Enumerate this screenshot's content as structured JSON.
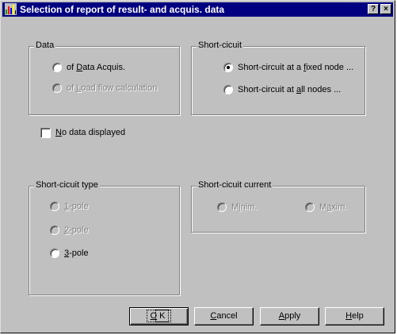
{
  "window": {
    "title": "Selection of report of result- and acquis. data",
    "help_glyph": "?",
    "close_glyph": "×"
  },
  "data_group": {
    "label": "Data",
    "options": [
      {
        "pre": "of ",
        "key": "D",
        "post": "ata Acquis.",
        "checked": false,
        "disabled": false
      },
      {
        "pre": "of ",
        "key": "L",
        "post": "oad flow calculation",
        "checked": false,
        "disabled": true
      }
    ]
  },
  "sc_group": {
    "label": "Short-cicuit",
    "options": [
      {
        "pre": "Short-circuit at a ",
        "key": "f",
        "post": "ixed node ...",
        "checked": true,
        "disabled": false
      },
      {
        "pre": "Short-circuit at ",
        "key": "a",
        "post": "ll nodes ...",
        "checked": false,
        "disabled": false
      }
    ]
  },
  "no_data": {
    "key": "N",
    "label_rest": "o data displayed",
    "checked": false
  },
  "sc_type_group": {
    "label": "Short-cicuit type",
    "options": [
      {
        "key": "1",
        "post": "-pole",
        "checked": false,
        "disabled": true
      },
      {
        "key": "2",
        "post": "-pole",
        "checked": false,
        "disabled": true
      },
      {
        "key": "3",
        "post": "-pole",
        "checked": false,
        "disabled": false
      }
    ]
  },
  "sc_current_group": {
    "label": "Short-cicuit current",
    "options": [
      {
        "pre": "M",
        "key": "i",
        "post": "nim.",
        "checked": false,
        "disabled": true
      },
      {
        "pre": "M",
        "key": "a",
        "post": "xim.",
        "checked": false,
        "disabled": true
      }
    ]
  },
  "buttons": {
    "ok": {
      "key": "O",
      "rest": "K"
    },
    "cancel": {
      "key": "C",
      "rest": "ancel"
    },
    "apply": {
      "key": "A",
      "rest": "pply"
    },
    "help": {
      "key": "H",
      "rest": "elp"
    }
  },
  "colors": {
    "titlebar": "#000080",
    "face": "#c0c0c0",
    "disabled_text": "#808080"
  }
}
